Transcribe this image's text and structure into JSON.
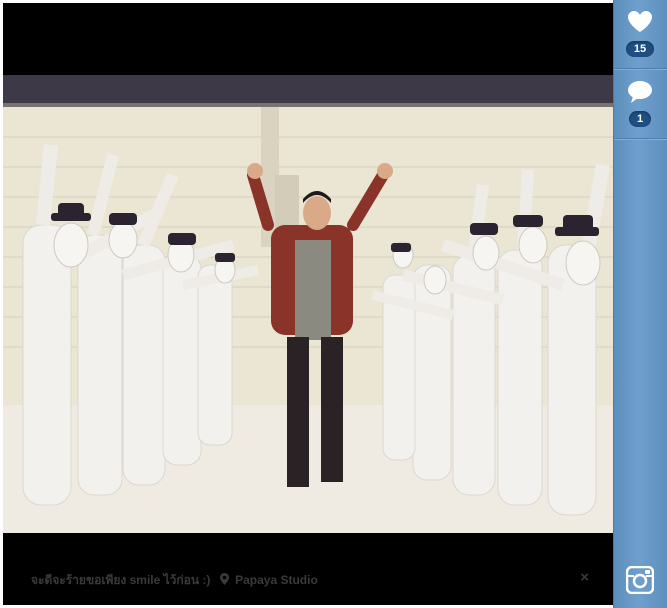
{
  "viewer": {
    "caption": "จะดีจะร้ายขอเพียง smile ไว้ก่อน :)",
    "location": "Papaya Studio",
    "close_label": "×"
  },
  "sidebar": {
    "likes_count": "15",
    "comments_count": "1"
  },
  "icons": {
    "like": "heart-icon",
    "comment": "speech-bubble-icon",
    "location": "location-pin-icon",
    "close": "close-icon",
    "brand": "camera-icon"
  },
  "colors": {
    "sidebar": "#6b9bc8",
    "badge": "#1f4e80",
    "panel": "#000000"
  }
}
